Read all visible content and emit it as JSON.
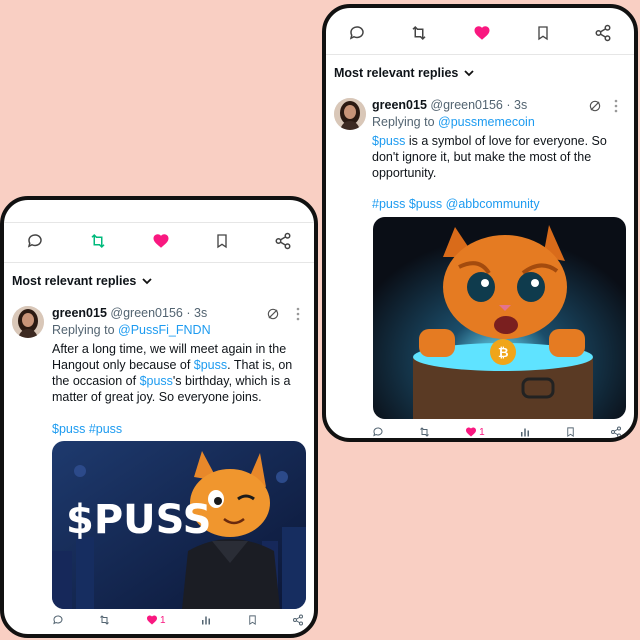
{
  "right_card": {
    "sort_label": "Most relevant replies",
    "user_name": "green015",
    "user_handle": "@green0156",
    "sep": "·",
    "time": "3s",
    "replying_prefix": "Replying to",
    "replying_handle": "@pussmemecoin",
    "body_link": "$puss",
    "body_rest": " is a symbol of love for everyone. So don't ignore it, but make the most of the opportunity.",
    "hashtags": "#puss $puss @abbcommunity",
    "like_count": "1"
  },
  "left_card": {
    "sort_label": "Most relevant replies",
    "user_name": "green015",
    "user_handle": "@green0156",
    "sep": "·",
    "time": "3s",
    "replying_prefix": "Replying to",
    "replying_handle": "@PussFi_FNDN",
    "body_p1": "After a long time, we will meet again in the Hangout only because of ",
    "body_link1": "$puss",
    "body_p2": ". That is, on the occasion of ",
    "body_link2": "$puss",
    "body_p3": "'s birthday, which is a matter of great joy. So everyone joins.",
    "hashtags": "$puss #puss",
    "banner_text": "$PUSS",
    "like_count": "1"
  },
  "colors": {
    "background": "#f9cfc3",
    "link": "#1d9bf0",
    "like": "#f91880",
    "retweet": "#00ba7c"
  },
  "icons": [
    "reply-icon",
    "retweet-icon",
    "heart-icon",
    "bookmark-icon",
    "share-icon",
    "grok-icon",
    "more-icon",
    "views-icon",
    "chevron-down-icon"
  ]
}
